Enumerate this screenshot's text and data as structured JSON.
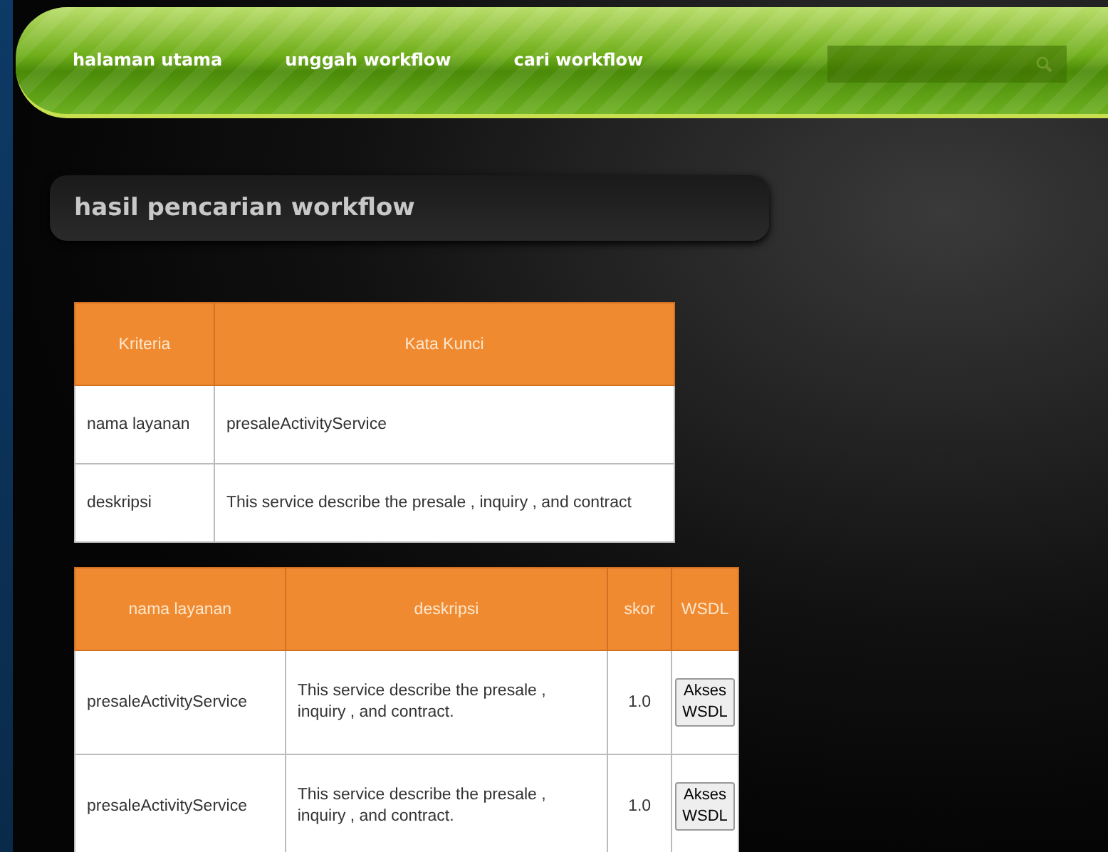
{
  "nav": {
    "items": [
      "halaman utama",
      "unggah workflow",
      "cari workflow"
    ]
  },
  "page_title": "hasil pencarian workflow",
  "criteria_table": {
    "columns": [
      "Kriteria",
      "Kata Kunci"
    ],
    "rows": [
      [
        "nama layanan",
        "presaleActivityService"
      ],
      [
        "deskripsi",
        "This service describe the presale , inquiry , and contract"
      ]
    ]
  },
  "results_table": {
    "columns": [
      "nama layanan",
      "deskripsi",
      "skor",
      "WSDL"
    ],
    "rows": [
      {
        "name": "presaleActivityService",
        "description": "This service describe the presale , inquiry , and contract.",
        "score": "1.0",
        "button": "Akses WSDL"
      },
      {
        "name": "presaleActivityService",
        "description": "This service describe the presale , inquiry , and contract.",
        "score": "1.0",
        "button": "Akses WSDL"
      }
    ]
  }
}
